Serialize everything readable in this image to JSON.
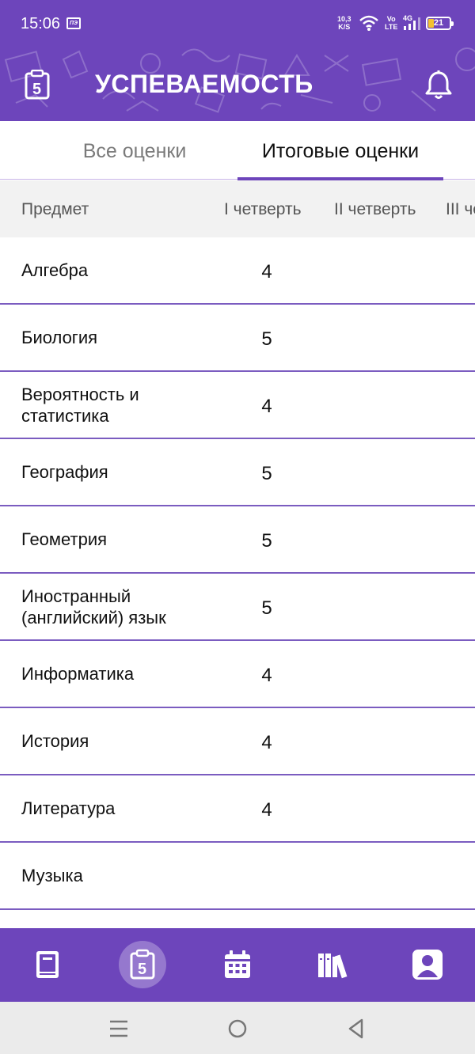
{
  "status_bar": {
    "time": "15:06",
    "sim_icon": "sim-card-icon",
    "net_speed_value": "10,3",
    "net_speed_unit": "K/S",
    "volte_top": "Vo",
    "volte_bottom": "LTE",
    "network_type": "4G",
    "battery_level": "21"
  },
  "header": {
    "title": "УСПЕВАЕМОСТЬ",
    "icon": "grade-clipboard-icon",
    "bell_icon": "bell-icon",
    "background_color": "#6d45bb"
  },
  "tabs": [
    {
      "label": "Все оценки",
      "active": false
    },
    {
      "label": "Итоговые оценки",
      "active": true
    }
  ],
  "table": {
    "columns": [
      "Предмет",
      "I четверть",
      "II четверть",
      "III че"
    ],
    "rows": [
      {
        "subject": "Алгебра",
        "q1": "4"
      },
      {
        "subject": "Биология",
        "q1": "5"
      },
      {
        "subject": "Вероятность и статистика",
        "q1": "4"
      },
      {
        "subject": "География",
        "q1": "5"
      },
      {
        "subject": "Геометрия",
        "q1": "5"
      },
      {
        "subject": "Иностранный (английский) язык",
        "q1": "5"
      },
      {
        "subject": "Информатика",
        "q1": "4"
      },
      {
        "subject": "История",
        "q1": "4"
      },
      {
        "subject": "Литература",
        "q1": "4"
      },
      {
        "subject": "Музыка",
        "q1": ""
      }
    ]
  },
  "bottom_nav": [
    {
      "icon": "diary-book-icon",
      "active": false
    },
    {
      "icon": "grades-clipboard-icon",
      "active": true
    },
    {
      "icon": "calendar-icon",
      "active": false
    },
    {
      "icon": "library-books-icon",
      "active": false
    },
    {
      "icon": "profile-icon",
      "active": false
    }
  ],
  "system_nav": [
    "menu-icon",
    "home-icon",
    "back-icon"
  ],
  "accent_color": "#6d45bb"
}
